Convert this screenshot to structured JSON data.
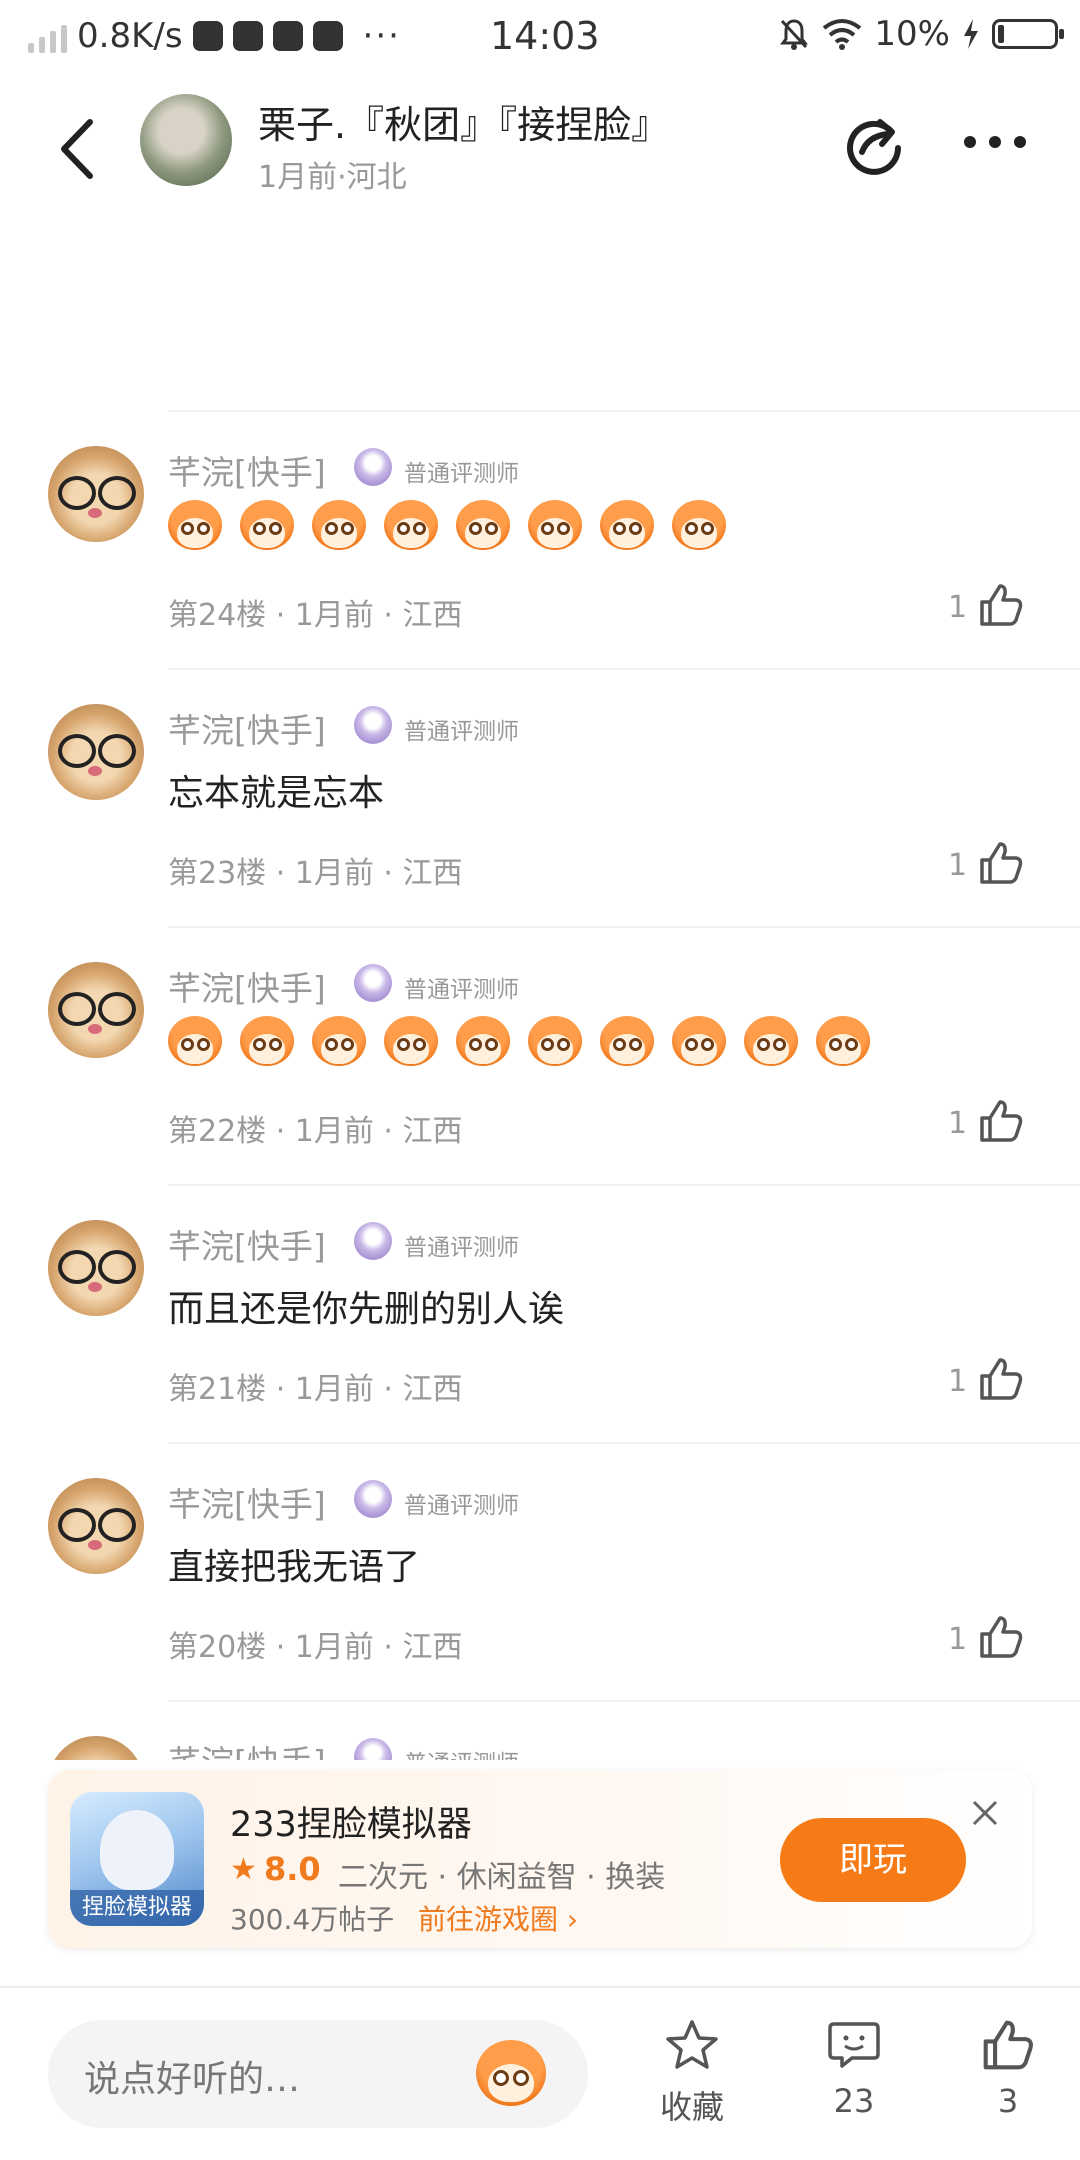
{
  "status_bar": {
    "speed": "0.8K/s",
    "dots": "···",
    "time": "14:03",
    "battery": "10%"
  },
  "header": {
    "title": "栗子.『秋团』『接捏脸』",
    "meta": "1月前·河北"
  },
  "comments": [
    {
      "name": "芊浣[快手]",
      "badge": "普通评测师",
      "emoji_count": 8,
      "floor": "第24楼 · 1月前 · 江西",
      "likes": "1"
    },
    {
      "name": "芊浣[快手]",
      "badge": "普通评测师",
      "text": "忘本就是忘本",
      "floor": "第23楼 · 1月前 · 江西",
      "likes": "1"
    },
    {
      "name": "芊浣[快手]",
      "badge": "普通评测师",
      "emoji_count": 10,
      "floor": "第22楼 · 1月前 · 江西",
      "likes": "1"
    },
    {
      "name": "芊浣[快手]",
      "badge": "普通评测师",
      "text": "而且还是你先删的别人诶",
      "floor": "第21楼 · 1月前 · 江西",
      "likes": "1"
    },
    {
      "name": "芊浣[快手]",
      "badge": "普通评测师",
      "text": "直接把我无语了",
      "floor": "第20楼 · 1月前 · 江西",
      "likes": "1"
    },
    {
      "name": "芊浣[快手]",
      "badge": "普通评测师"
    }
  ],
  "promo": {
    "title": "233捏脸模拟器",
    "icon_caption": "捏脸模拟器",
    "rating": "8.0",
    "tags": "二次元 · 休闲益智 · 换装",
    "posts": "300.4万帖子",
    "link": "前往游戏圈",
    "button": "即玩"
  },
  "bottom": {
    "placeholder": "说点好听的…",
    "favorite_label": "收藏",
    "comments_count": "23",
    "likes_count": "3"
  },
  "colors": {
    "accent": "#f67a16",
    "meta_gray": "#999999"
  }
}
